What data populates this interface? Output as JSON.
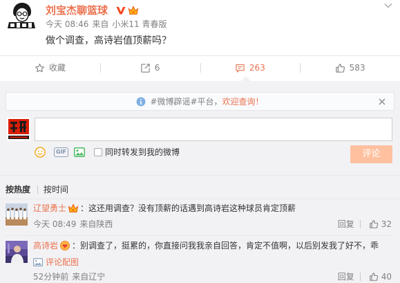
{
  "post": {
    "author": "刘宝杰聊篮球",
    "badges": [
      "verified-v-icon",
      "member-crown-icon"
    ],
    "time": "今天 08:46",
    "source_prefix": "来自",
    "source": "小米11 青春版",
    "text": "做个调查，高诗岩值顶薪吗？"
  },
  "actions": {
    "favorite": {
      "icon": "star-icon",
      "label": "收藏"
    },
    "forward": {
      "icon": "forward-icon",
      "label": "6"
    },
    "comment": {
      "icon": "comment-icon",
      "label": "263",
      "active": true
    },
    "like": {
      "icon": "thumbs-up-icon",
      "label": "583"
    }
  },
  "notice": {
    "icon": "info-icon",
    "text": "#微博辟谣#平台，",
    "link": "欢迎查询！"
  },
  "composer": {
    "input_value": "",
    "gif_label": "GIF",
    "repost_label": "同时转发到我的微博",
    "repost_checked": false,
    "submit_label": "评论"
  },
  "sort_tabs": {
    "hot": "按热度",
    "time": "按时间",
    "active": "hot"
  },
  "comments": [
    {
      "author": "辽望勇士",
      "badge": "member-crown-icon",
      "text": "：这还用调查？没有顶薪的话遇到高诗岩这种球员肯定顶薪",
      "time": "今天 08:49",
      "location": "来自陕西",
      "reply_label": "回复",
      "likes": "32"
    },
    {
      "author": "高诗岩",
      "badge": "emoji-badge-icon",
      "text": "：别调查了，挺累的，你直接问我我亲自回答，肯定不值啊，以后别发我了好不，乖",
      "attachment_label": "评论配图",
      "time": "52分钟前",
      "location": "来自辽宁",
      "reply_label": "回复",
      "likes": "40"
    }
  ],
  "colors": {
    "accent": "#eb7350",
    "text": "#333333",
    "muted": "#808080",
    "panel": "#f2f2f5",
    "submit_disabled": "#ffc09f",
    "info": "#7fb0e3"
  }
}
